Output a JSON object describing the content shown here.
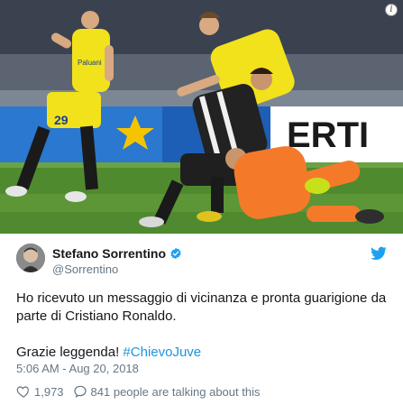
{
  "tweet": {
    "author_name": "Stefano Sorrentino",
    "handle": "@Sorrentino",
    "text_line1": "Ho ricevuto un messaggio di vicinanza e pronta guarigione da parte di Cristiano Ronaldo.",
    "text_line2_prefix": "Grazie leggenda! ",
    "hashtag": "#ChievoJuve",
    "timestamp": "5:06 AM - Aug 20, 2018",
    "like_count": "1,973",
    "talking_text": "841 people are talking about this"
  },
  "photo": {
    "jersey_number": "29",
    "billboard_text": "ERTI",
    "sponsor_text": "Paluani"
  },
  "colors": {
    "link": "#1b95e0",
    "muted": "#657786",
    "verified": "#1da1f2",
    "chievo_yellow": "#f2e21c",
    "keeper_orange": "#f47a2a"
  },
  "icons": [
    "info-icon",
    "verified-icon",
    "twitter-bird-icon",
    "heart-icon",
    "comment-icon"
  ]
}
